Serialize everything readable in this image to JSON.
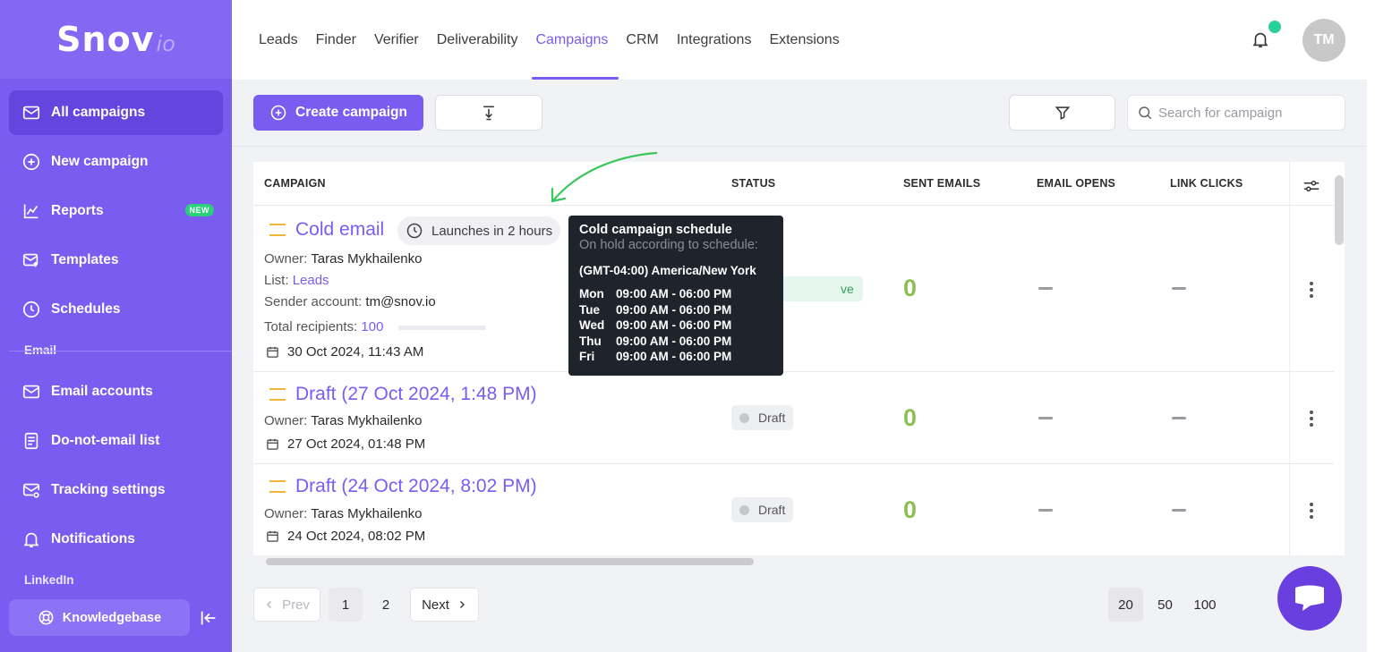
{
  "logo": {
    "main": "Snov",
    "sub": "io"
  },
  "sidebar": {
    "items": [
      {
        "label": "All campaigns"
      },
      {
        "label": "New campaign"
      },
      {
        "label": "Reports",
        "badge": "NEW"
      },
      {
        "label": "Templates"
      },
      {
        "label": "Schedules"
      }
    ],
    "email_section": "Email",
    "email_items": [
      {
        "label": "Email accounts"
      },
      {
        "label": "Do-not-email list"
      },
      {
        "label": "Tracking settings"
      },
      {
        "label": "Notifications"
      }
    ],
    "linkedin_section": "LinkedIn",
    "knowledgebase": "Knowledgebase"
  },
  "nav": {
    "items": [
      "Leads",
      "Finder",
      "Verifier",
      "Deliverability",
      "Campaigns",
      "CRM",
      "Integrations",
      "Extensions"
    ],
    "active": "Campaigns",
    "avatar_initials": "TM"
  },
  "toolbar": {
    "create_label": "Create campaign",
    "search_placeholder": "Search for campaign"
  },
  "table": {
    "headers": {
      "campaign": "CAMPAIGN",
      "status": "STATUS",
      "sent": "SENT EMAILS",
      "opens": "EMAIL OPENS",
      "clicks": "LINK CLICKS"
    },
    "rows": [
      {
        "name": "Cold email",
        "launch": "Launches in 2 hours",
        "owner_label": "Owner:",
        "owner": "Taras Mykhailenko",
        "list_label": "List:",
        "list": "Leads",
        "sender_label": "Sender account:",
        "sender": "tm@snov.io",
        "recipients_label": "Total recipients:",
        "recipients": "100",
        "date": "30 Oct 2024, 11:43 AM",
        "status": "ve",
        "sent": "0"
      },
      {
        "name": "Draft (27 Oct 2024, 1:48 PM)",
        "owner_label": "Owner:",
        "owner": "Taras Mykhailenko",
        "date": "27 Oct 2024, 01:48 PM",
        "status": "Draft",
        "sent": "0"
      },
      {
        "name": "Draft (24 Oct 2024, 8:02 PM)",
        "owner_label": "Owner:",
        "owner": "Taras Mykhailenko",
        "date": "24 Oct 2024, 08:02 PM",
        "status": "Draft",
        "sent": "0"
      }
    ]
  },
  "tooltip": {
    "title": "Cold campaign schedule",
    "subtitle": "On hold according to schedule:",
    "timezone": "(GMT-04:00) America/New York",
    "schedule": [
      {
        "day": "Mon",
        "hours": "09:00 AM - 06:00 PM"
      },
      {
        "day": "Tue",
        "hours": "09:00 AM - 06:00 PM"
      },
      {
        "day": "Wed",
        "hours": "09:00 AM - 06:00 PM"
      },
      {
        "day": "Thu",
        "hours": "09:00 AM - 06:00 PM"
      },
      {
        "day": "Fri",
        "hours": "09:00 AM - 06:00 PM"
      }
    ]
  },
  "pagination": {
    "prev": "Prev",
    "next": "Next",
    "pages": [
      "1",
      "2"
    ],
    "current_page": "1",
    "per_page": [
      "20",
      "50",
      "100"
    ],
    "current_per_page": "20"
  },
  "colors": {
    "brand": "#7a5cf0",
    "sidebar": "#7a5cf0",
    "success": "#8cc152",
    "accent_dot": "#2ad09a"
  }
}
